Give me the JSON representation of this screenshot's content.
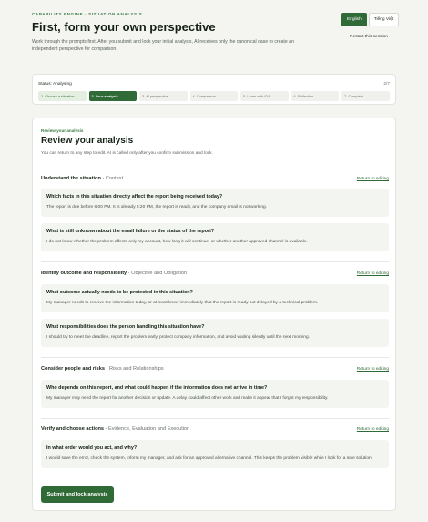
{
  "header": {
    "eyebrow": "CAPABILITY ENGINE · SITUATION ANALYSIS",
    "title": "First, form your own perspective",
    "subtitle": "Work through the prompts first. After you submit and lock your initial analysis, AI receives only the canonical case to create an independent perspective for comparison.",
    "lang_english": "English",
    "lang_vietnamese": "Tiếng Việt",
    "restart": "Restart this session"
  },
  "status": {
    "label": "Status: Analysing",
    "count": "2/7",
    "steps": [
      "1. Choose a situation",
      "2. Your analysis",
      "3. AI perspective",
      "4. Comparison",
      "5. Learn with IDA",
      "6. Reflection",
      "7. Complete"
    ]
  },
  "review": {
    "eyebrow": "Review your analysis",
    "title": "Review your analysis",
    "note": "You can return to any step to edit. AI is called only after you confirm submission and lock.",
    "return_label": "Return to editing",
    "submit_label": "Submit and lock analysis",
    "sections": [
      {
        "title": "Understand the situation",
        "sub": "Context",
        "items": [
          {
            "q": "Which facts in this situation directly affect the report being received today?",
            "a": "The report is due before 6:00 PM. It is already 5:20 PM, the report is ready, and the company email is not working."
          },
          {
            "q": "What is still unknown about the email failure or the status of the report?",
            "a": "I do not know whether the problem affects only my account, how long it will continue, or whether another approved channel is available."
          }
        ]
      },
      {
        "title": "Identify outcome and responsibility",
        "sub": "Objective and Obligation",
        "items": [
          {
            "q": "What outcome actually needs to be protected in this situation?",
            "a": "My manager needs to receive the information today, or at least know immediately that the report is ready but delayed by a technical problem."
          },
          {
            "q": "What responsibilities does the person handling this situation have?",
            "a": "I should try to meet the deadline, report the problem early, protect company information, and avoid waiting silently until the next morning."
          }
        ]
      },
      {
        "title": "Consider people and risks",
        "sub": "Risks and Relationships",
        "items": [
          {
            "q": "Who depends on this report, and what could happen if the information does not arrive in time?",
            "a": "My manager may need the report for another decision or update. A delay could affect other work and make it appear that I forgot my responsibility."
          }
        ]
      },
      {
        "title": "Verify and choose actions",
        "sub": "Evidence, Evaluation and Execution",
        "items": [
          {
            "q": "In what order would you act, and why?",
            "a": "I would save the error, check the system, inform my manager, and ask for an approved alternative channel. This keeps the problem visible while I look for a safe solution."
          }
        ]
      }
    ]
  }
}
